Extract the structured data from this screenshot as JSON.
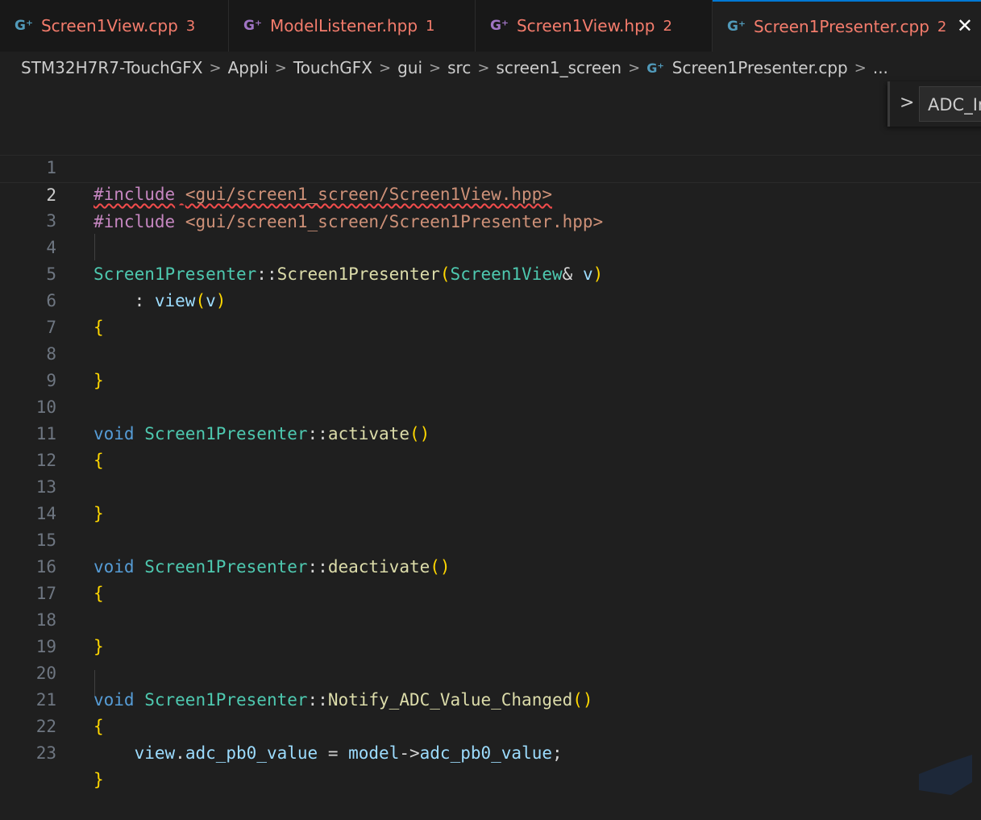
{
  "tabs": [
    {
      "name": "Screen1View.cpp",
      "count": "3",
      "icon": "C++",
      "active": false
    },
    {
      "name": "ModelListener.hpp",
      "count": "1",
      "icon": "C++",
      "active": false
    },
    {
      "name": "Screen1View.hpp",
      "count": "2",
      "icon": "C++",
      "active": false
    },
    {
      "name": "Screen1Presenter.cpp",
      "count": "2",
      "icon": "C++",
      "active": true,
      "close": "✕"
    }
  ],
  "breadcrumb": {
    "items": [
      "STM32H7R7-TouchGFX",
      "Appli",
      "TouchGFX",
      "gui",
      "src",
      "screen1_screen",
      "Screen1Presenter.cpp",
      "..."
    ],
    "separator": ">"
  },
  "sticky_scroll": {
    "chevron": ">",
    "label": "ADC_In"
  },
  "editor": {
    "current_line": 2,
    "lines": [
      {
        "n": "1",
        "text": "#include <gui/screen1_screen/Screen1View.hpp>"
      },
      {
        "n": "2",
        "text": "#include <gui/screen1_screen/Screen1Presenter.hpp>"
      },
      {
        "n": "3",
        "text": ""
      },
      {
        "n": "4",
        "text": "Screen1Presenter::Screen1Presenter(Screen1View& v)"
      },
      {
        "n": "5",
        "text": "    : view(v)"
      },
      {
        "n": "6",
        "text": "{"
      },
      {
        "n": "7",
        "text": ""
      },
      {
        "n": "8",
        "text": "}"
      },
      {
        "n": "9",
        "text": ""
      },
      {
        "n": "10",
        "text": "void Screen1Presenter::activate()"
      },
      {
        "n": "11",
        "text": "{"
      },
      {
        "n": "12",
        "text": ""
      },
      {
        "n": "13",
        "text": "}"
      },
      {
        "n": "14",
        "text": ""
      },
      {
        "n": "15",
        "text": "void Screen1Presenter::deactivate()"
      },
      {
        "n": "16",
        "text": "{"
      },
      {
        "n": "17",
        "text": ""
      },
      {
        "n": "18",
        "text": "}"
      },
      {
        "n": "19",
        "text": ""
      },
      {
        "n": "20",
        "text": "void Screen1Presenter::Notify_ADC_Value_Changed()"
      },
      {
        "n": "21",
        "text": "{"
      },
      {
        "n": "22",
        "text": "    view.adc_pb0_value = model->adc_pb0_value;"
      },
      {
        "n": "23",
        "text": "}"
      }
    ]
  },
  "colors": {
    "accent": "#0078d4",
    "error": "#f14c4c",
    "tab_text_error": "#f47c6c",
    "cpp_icon": "#a074c4"
  }
}
